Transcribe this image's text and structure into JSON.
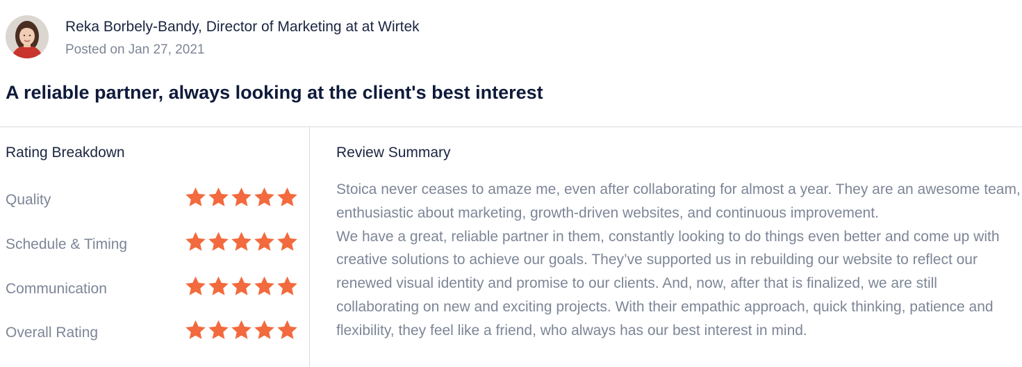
{
  "review": {
    "author": {
      "name_line": "Reka Borbely-Bandy, Director of Marketing at at Wirtek",
      "posted_prefix": "Posted on",
      "posted_date": "Jan 27, 2021"
    },
    "title": "A reliable partner, always looking at the client's best interest",
    "rating_breakdown": {
      "heading": "Rating Breakdown",
      "star_color": "#f26a3d",
      "items": [
        {
          "label": "Quality",
          "stars": 5
        },
        {
          "label": "Schedule & Timing",
          "stars": 5
        },
        {
          "label": "Communication",
          "stars": 5
        },
        {
          "label": "Overall Rating",
          "stars": 5
        }
      ]
    },
    "summary": {
      "heading": "Review Summary",
      "paragraphs": [
        "Stoica never ceases to amaze me, even after collaborating for almost a year. They are an awesome team, enthusiastic about marketing, growth-driven websites, and continuous improvement.",
        "We have a great, reliable partner in them, constantly looking to do things even better and come up with creative solutions to achieve our goals. They’ve supported us in rebuilding our website to reflect our renewed visual identity and promise to our clients. And, now, after that is finalized, we are still collaborating on new and exciting projects. With their empathic approach, quick thinking, patience and flexibility, they feel like a friend, who always has our best interest in mind."
      ]
    }
  }
}
